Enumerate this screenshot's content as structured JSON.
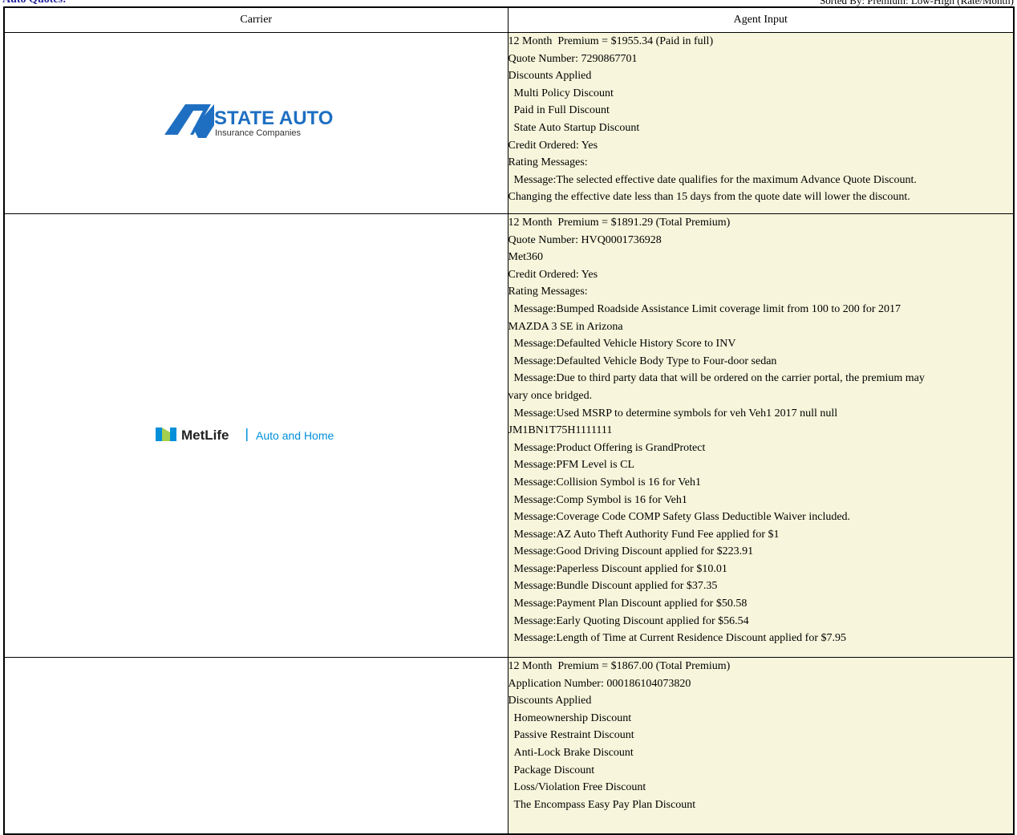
{
  "header": {
    "title": "Auto Quotes:",
    "sorted": "Sorted By: Premium: Low-High (Rate/Month)"
  },
  "table": {
    "columns": [
      "Carrier",
      "Agent Input"
    ],
    "rows": [
      {
        "carrier_logo": "state-auto-logo",
        "logo_text_main": "STATE AUTO",
        "logo_text_sub": "Insurance Companies",
        "lines": [
          "12 Month  Premium = $1955.34 (Paid in full)",
          "Quote Number: 7290867701",
          "Discounts Applied",
          "  Multi Policy Discount",
          "  Paid in Full Discount",
          "  State Auto Startup Discount",
          "Credit Ordered: Yes",
          "Rating Messages:",
          "  Message:The selected effective date qualifies for the maximum Advance Quote Discount.",
          "Changing the effective date less than 15 days from the quote date will lower the discount."
        ]
      },
      {
        "carrier_logo": "metlife-logo",
        "logo_text_main": "MetLife",
        "logo_text_sub": "Auto and Home",
        "lines": [
          "12 Month  Premium = $1891.29 (Total Premium)",
          "Quote Number: HVQ0001736928",
          "Met360",
          "Credit Ordered: Yes",
          "Rating Messages:",
          "  Message:Bumped Roadside Assistance Limit coverage limit from 100 to 200 for 2017",
          "MAZDA 3 SE in Arizona",
          "  Message:Defaulted Vehicle History Score to INV",
          "  Message:Defaulted Vehicle Body Type to Four-door sedan",
          "  Message:Due to third party data that will be ordered on the carrier portal, the premium may",
          "vary once bridged.",
          "  Message:Used MSRP to determine symbols for veh Veh1 2017 null null",
          "JM1BN1T75H1111111",
          "  Message:Product Offering is GrandProtect",
          "  Message:PFM Level is CL",
          "  Message:Collision Symbol is 16 for Veh1",
          "  Message:Comp Symbol is 16 for Veh1",
          "  Message:Coverage Code COMP Safety Glass Deductible Waiver included.",
          "  Message:AZ Auto Theft Authority Fund Fee applied for $1",
          "  Message:Good Driving Discount applied for $223.91",
          "  Message:Paperless Discount applied for $10.01",
          "  Message:Bundle Discount applied for $37.35",
          "  Message:Payment Plan Discount applied for $50.58",
          "  Message:Early Quoting Discount applied for $56.54",
          "  Message:Length of Time at Current Residence Discount applied for $7.95"
        ]
      },
      {
        "carrier_logo": "",
        "lines": [
          "12 Month  Premium = $1867.00 (Total Premium)",
          "Application Number: 000186104073820",
          "Discounts Applied",
          "  Homeownership Discount",
          "  Passive Restraint Discount",
          "  Anti-Lock Brake Discount",
          "  Package Discount",
          "  Loss/Violation Free Discount",
          "  The Encompass Easy Pay Plan Discount"
        ]
      }
    ]
  },
  "colors": {
    "title": "#1f1f9a",
    "input_bg": "#f7f6dc",
    "state_auto_blue": "#1e6fc2",
    "metlife_blue": "#0090da",
    "metlife_green": "#a4ce4e"
  }
}
